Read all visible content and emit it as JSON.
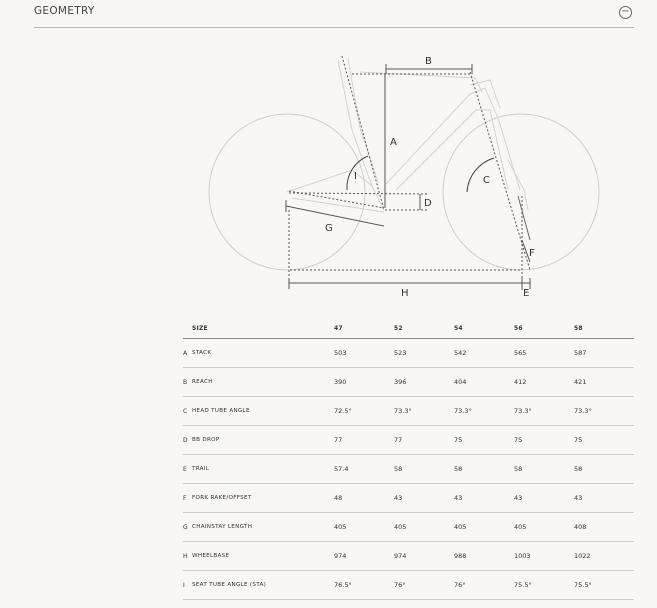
{
  "header": {
    "title": "GEOMETRY",
    "collapse_icon": "minus-circle-icon"
  },
  "diagram": {
    "labels": {
      "A": "A",
      "B": "B",
      "C": "C",
      "D": "D",
      "E": "E",
      "F": "F",
      "G": "G",
      "H": "H",
      "I": "I"
    }
  },
  "table": {
    "size_label": "SIZE",
    "sizes": [
      "47",
      "52",
      "54",
      "56",
      "58"
    ],
    "rows": [
      {
        "letter": "A",
        "name": "STACK",
        "values": [
          "503",
          "523",
          "542",
          "565",
          "587"
        ]
      },
      {
        "letter": "B",
        "name": "REACH",
        "values": [
          "390",
          "396",
          "404",
          "412",
          "421"
        ]
      },
      {
        "letter": "C",
        "name": "HEAD TUBE ANGLE",
        "values": [
          "72.5°",
          "73.3°",
          "73.3°",
          "73.3°",
          "73.3°"
        ]
      },
      {
        "letter": "D",
        "name": "BB DROP",
        "values": [
          "77",
          "77",
          "75",
          "75",
          "75"
        ]
      },
      {
        "letter": "E",
        "name": "TRAIL",
        "values": [
          "57.4",
          "58",
          "58",
          "58",
          "58"
        ]
      },
      {
        "letter": "F",
        "name": "FORK RAKE/OFFSET",
        "values": [
          "48",
          "43",
          "43",
          "43",
          "43"
        ]
      },
      {
        "letter": "G",
        "name": "CHAINSTAY LENGTH",
        "values": [
          "405",
          "405",
          "405",
          "405",
          "408"
        ]
      },
      {
        "letter": "H",
        "name": "WHEELBASE",
        "values": [
          "974",
          "974",
          "988",
          "1003",
          "1022"
        ]
      },
      {
        "letter": "I",
        "name": "SEAT TUBE ANGLE (STA)",
        "values": [
          "76.5°",
          "76°",
          "76°",
          "75.5°",
          "75.5°"
        ]
      }
    ]
  }
}
